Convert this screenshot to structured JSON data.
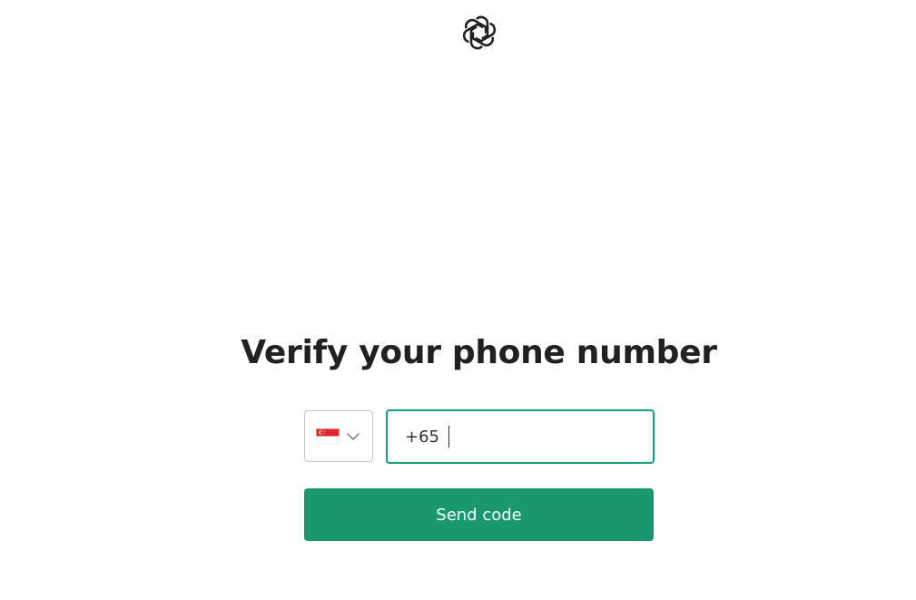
{
  "header": {
    "logo_icon": "openai-logo-icon"
  },
  "main": {
    "title": "Verify your phone number",
    "country_select": {
      "flag_icon": "singapore-flag-icon",
      "chevron_icon": "chevron-down-icon"
    },
    "phone_input": {
      "value": "+65"
    },
    "send_button_label": "Send code"
  },
  "colors": {
    "accent": "#10a37f",
    "button": "#19976f",
    "text": "#202123",
    "border": "#c2c8d0",
    "flag_red": "#e0272f"
  }
}
